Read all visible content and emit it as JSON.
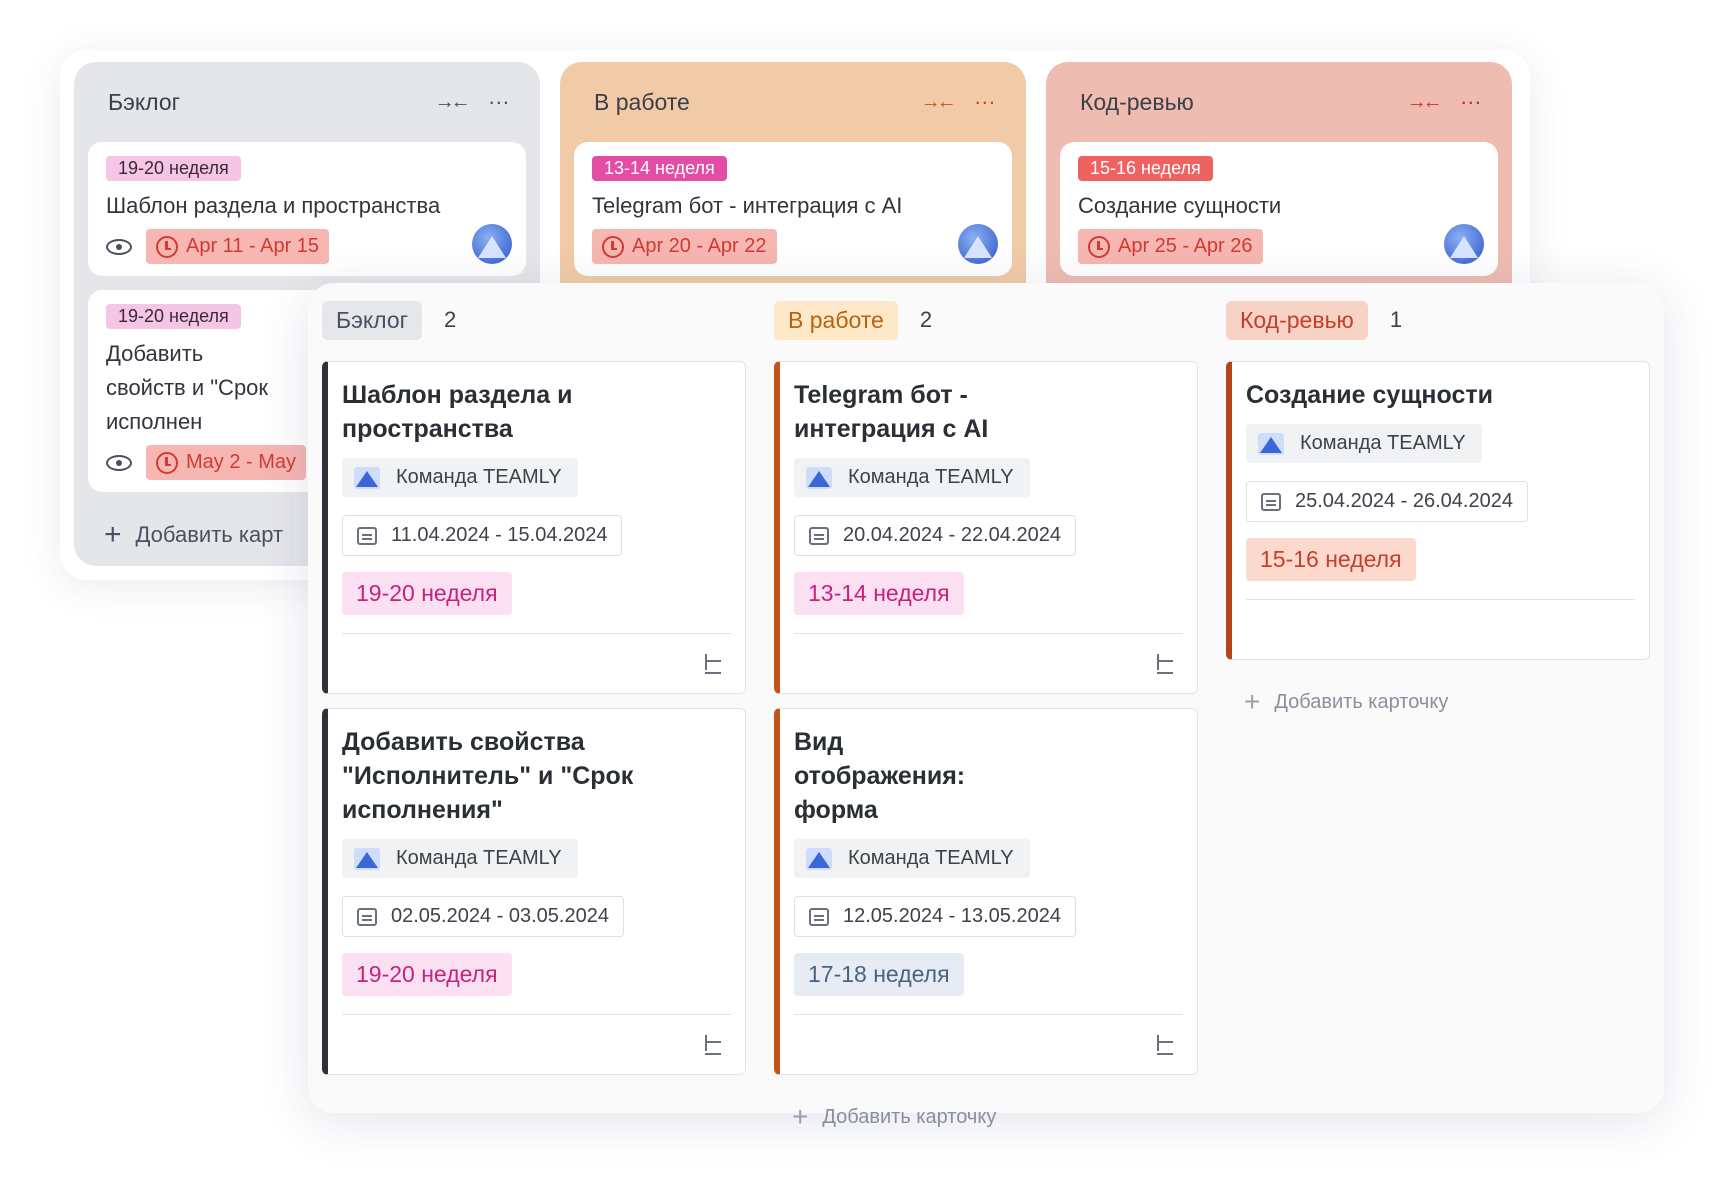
{
  "background_board": {
    "columns": [
      {
        "title": "Бэклог",
        "cards": [
          {
            "tag": "19-20 неделя",
            "title": "Шаблон раздела и пространства",
            "dates": "Apr 11 - Apr 15"
          },
          {
            "tag": "19-20 неделя",
            "title": "Добавить свойств и \"Срок исполнен",
            "dates": "May 2 - May"
          }
        ],
        "add_label": "Добавить карт"
      },
      {
        "title": "В работе",
        "cards": [
          {
            "tag": "13-14 неделя",
            "title": "Telegram бот - интеграция с AI",
            "dates": "Apr 20 - Apr 22"
          }
        ]
      },
      {
        "title": "Код-ревью",
        "cards": [
          {
            "tag": "15-16 неделя",
            "title": "Создание сущности",
            "dates": "Apr 25 - Apr 26"
          }
        ]
      }
    ]
  },
  "board": {
    "columns": [
      {
        "status": "Бэклог",
        "count": "2",
        "cards": [
          {
            "title": "Шаблон раздела и пространства",
            "team": "Команда TEAMLY",
            "dates": "11.04.2024 - 15.04.2024",
            "week": "19-20 неделя"
          },
          {
            "title": "Добавить свойства \"Исполнитель\" и \"Срок исполнения\"",
            "team": "Команда TEAMLY",
            "dates": "02.05.2024 - 03.05.2024",
            "week": "19-20 неделя"
          }
        ]
      },
      {
        "status": "В работе",
        "count": "2",
        "cards": [
          {
            "title": "Telegram бот - интеграция с AI",
            "team": "Команда TEAMLY",
            "dates": "20.04.2024 - 22.04.2024",
            "week": "13-14 неделя"
          },
          {
            "title": "Вид отображения: форма",
            "team": "Команда TEAMLY",
            "dates": "12.05.2024 - 13.05.2024",
            "week": "17-18 неделя"
          }
        ],
        "add_label": "Добавить карточку"
      },
      {
        "status": "Код-ревью",
        "count": "1",
        "cards": [
          {
            "title": "Создание сущности",
            "team": "Команда TEAMLY",
            "dates": "25.04.2024 - 26.04.2024",
            "week": "15-16 неделя"
          }
        ],
        "add_label": "Добавить карточку"
      }
    ]
  },
  "icons": {
    "collapse": "collapse-arrows-icon",
    "more": "more-dots-icon",
    "eye": "eye-icon",
    "clock": "clock-icon",
    "calendar": "calendar-icon",
    "subtasks": "subtasks-icon",
    "plus": "plus-icon",
    "team": "team-logo-icon"
  },
  "colors": {
    "backlog_accent": "#2f3238",
    "in_progress_accent": "#c2541a",
    "review_accent": "#b5431c",
    "week_pink": "#c8227f",
    "week_blue": "#4b6382",
    "week_salmon": "#c8402a"
  }
}
